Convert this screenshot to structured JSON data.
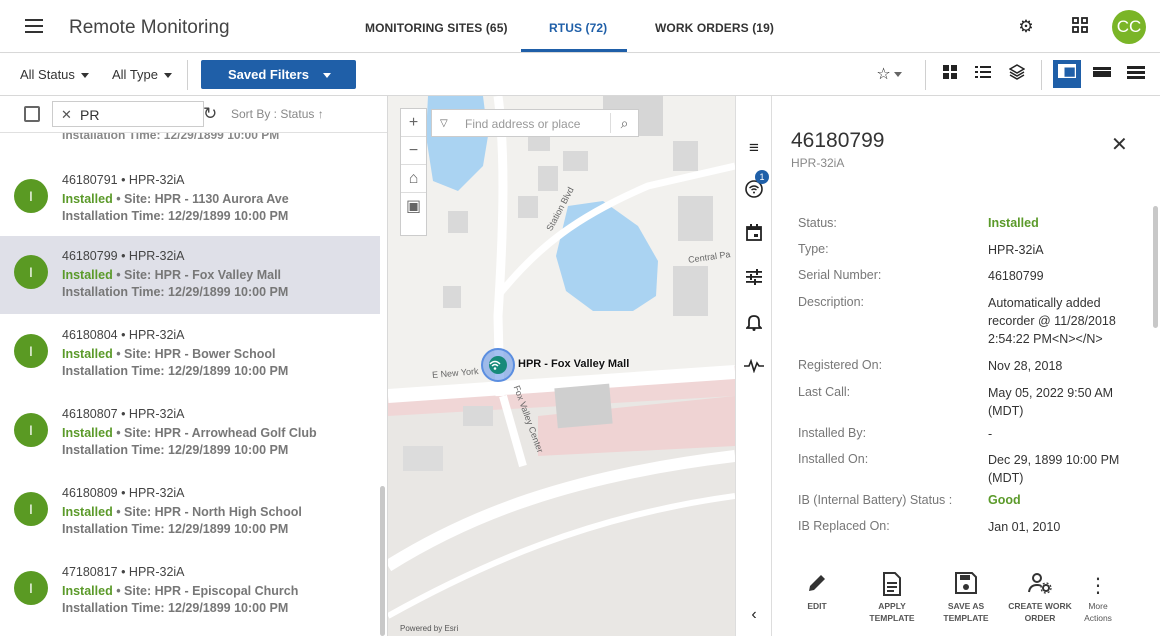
{
  "app": {
    "title": "Remote Monitoring",
    "avatar_initials": "CC"
  },
  "tabs": [
    {
      "label": "MONITORING SITES (65)"
    },
    {
      "label": "RTUS (72)"
    },
    {
      "label": "WORK ORDERS (19)"
    }
  ],
  "filters": {
    "status": "All Status",
    "type": "All Type",
    "saved": "Saved Filters"
  },
  "list": {
    "search_value": "PR",
    "sort_label": "Sort By : Status",
    "cut_row": "Installation Time: 12/29/1899 10:00 PM",
    "items": [
      {
        "avatar": "I",
        "title": "46180791 • HPR-32iA",
        "status": "Installed",
        "site": " • Site: HPR - 1130 Aurora Ave",
        "time": "Installation Time: 12/29/1899 10:00 PM"
      },
      {
        "avatar": "I",
        "title": "46180799 • HPR-32iA",
        "status": "Installed",
        "site": " • Site: HPR - Fox Valley Mall",
        "time": "Installation Time: 12/29/1899 10:00 PM"
      },
      {
        "avatar": "I",
        "title": "46180804 • HPR-32iA",
        "status": "Installed",
        "site": " • Site: HPR - Bower School",
        "time": "Installation Time: 12/29/1899 10:00 PM"
      },
      {
        "avatar": "I",
        "title": "46180807 • HPR-32iA",
        "status": "Installed",
        "site": " • Site: HPR - Arrowhead Golf Club",
        "time": "Installation Time: 12/29/1899 10:00 PM"
      },
      {
        "avatar": "I",
        "title": "46180809 • HPR-32iA",
        "status": "Installed",
        "site": " • Site: HPR - North High School",
        "time": "Installation Time: 12/29/1899 10:00 PM"
      },
      {
        "avatar": "I",
        "title": "47180817 • HPR-32iA",
        "status": "Installed",
        "site": " • Site: HPR - Episcopal Church",
        "time": "Installation Time: 12/29/1899 10:00 PM"
      }
    ]
  },
  "map": {
    "search_placeholder": "Find address or place",
    "pin_label": "HPR - Fox Valley Mall",
    "road_station": "Station Blvd",
    "road_central": "Central Pa",
    "road_newyork": "E New York",
    "road_foxcenter": "Fox Valley Center",
    "attribution": "Powered by Esri"
  },
  "side": {
    "badge": "1"
  },
  "detail": {
    "title": "46180799",
    "subtitle": "HPR-32iA",
    "rows": [
      {
        "label": "Status:",
        "value": "Installed"
      },
      {
        "label": "Type:",
        "value": "HPR-32iA"
      },
      {
        "label": "Serial Number:",
        "value": "46180799"
      },
      {
        "label": "Description:",
        "value": "Automatically added recorder @ 11/28/2018 2:54:22 PM<N></N>"
      },
      {
        "label": "Registered On:",
        "value": "Nov 28, 2018"
      },
      {
        "label": "Last Call:",
        "value": "May 05, 2022 9:50 AM (MDT)"
      },
      {
        "label": "Installed By:",
        "value": "-"
      },
      {
        "label": "Installed On:",
        "value": "Dec 29, 1899 10:00 PM (MDT)"
      },
      {
        "label": "IB (Internal Battery) Status :",
        "value": "Good"
      },
      {
        "label": "IB Replaced On:",
        "value": "Jan 01, 2010"
      }
    ],
    "actions": [
      {
        "line1": "EDIT",
        "line2": ""
      },
      {
        "line1": "APPLY TEMPLATE",
        "line2": ""
      },
      {
        "line1": "SAVE AS",
        "line2": "TEMPLATE"
      },
      {
        "line1": "CREATE WORK",
        "line2": "ORDER"
      },
      {
        "line1": "More",
        "line2": "Actions"
      }
    ]
  },
  "colors": {
    "accent": "#1f5fa8",
    "installed": "#5b9a2a",
    "avatar": "#7ab527"
  }
}
